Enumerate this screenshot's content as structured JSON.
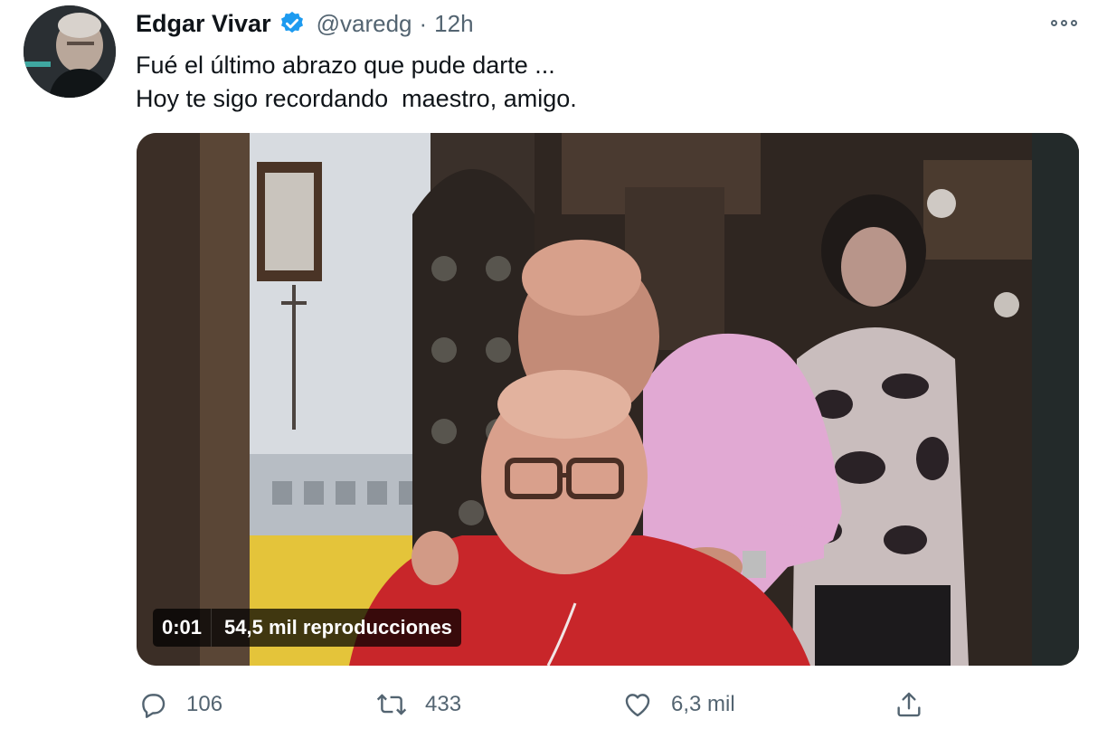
{
  "author": {
    "name": "Edgar Vivar",
    "handle": "@varedg",
    "separator": "·",
    "time": "12h",
    "verified": true
  },
  "tweet": {
    "line1": "Fué el último abrazo que pude darte ...",
    "line2": "Hoy te sigo recordando  maestro, amigo."
  },
  "video": {
    "elapsed": "0:01",
    "views": "54,5 mil reproducciones"
  },
  "actions": {
    "replies": "106",
    "retweets": "433",
    "likes": "6,3 mil"
  },
  "icons": {
    "verified": "verified-badge-icon",
    "more": "more-options-icon",
    "reply": "reply-icon",
    "retweet": "retweet-icon",
    "like": "heart-icon",
    "share": "share-icon"
  },
  "colors": {
    "verified": "#1d9bf0",
    "secondary_text": "#536471",
    "primary_text": "#0f1419"
  }
}
